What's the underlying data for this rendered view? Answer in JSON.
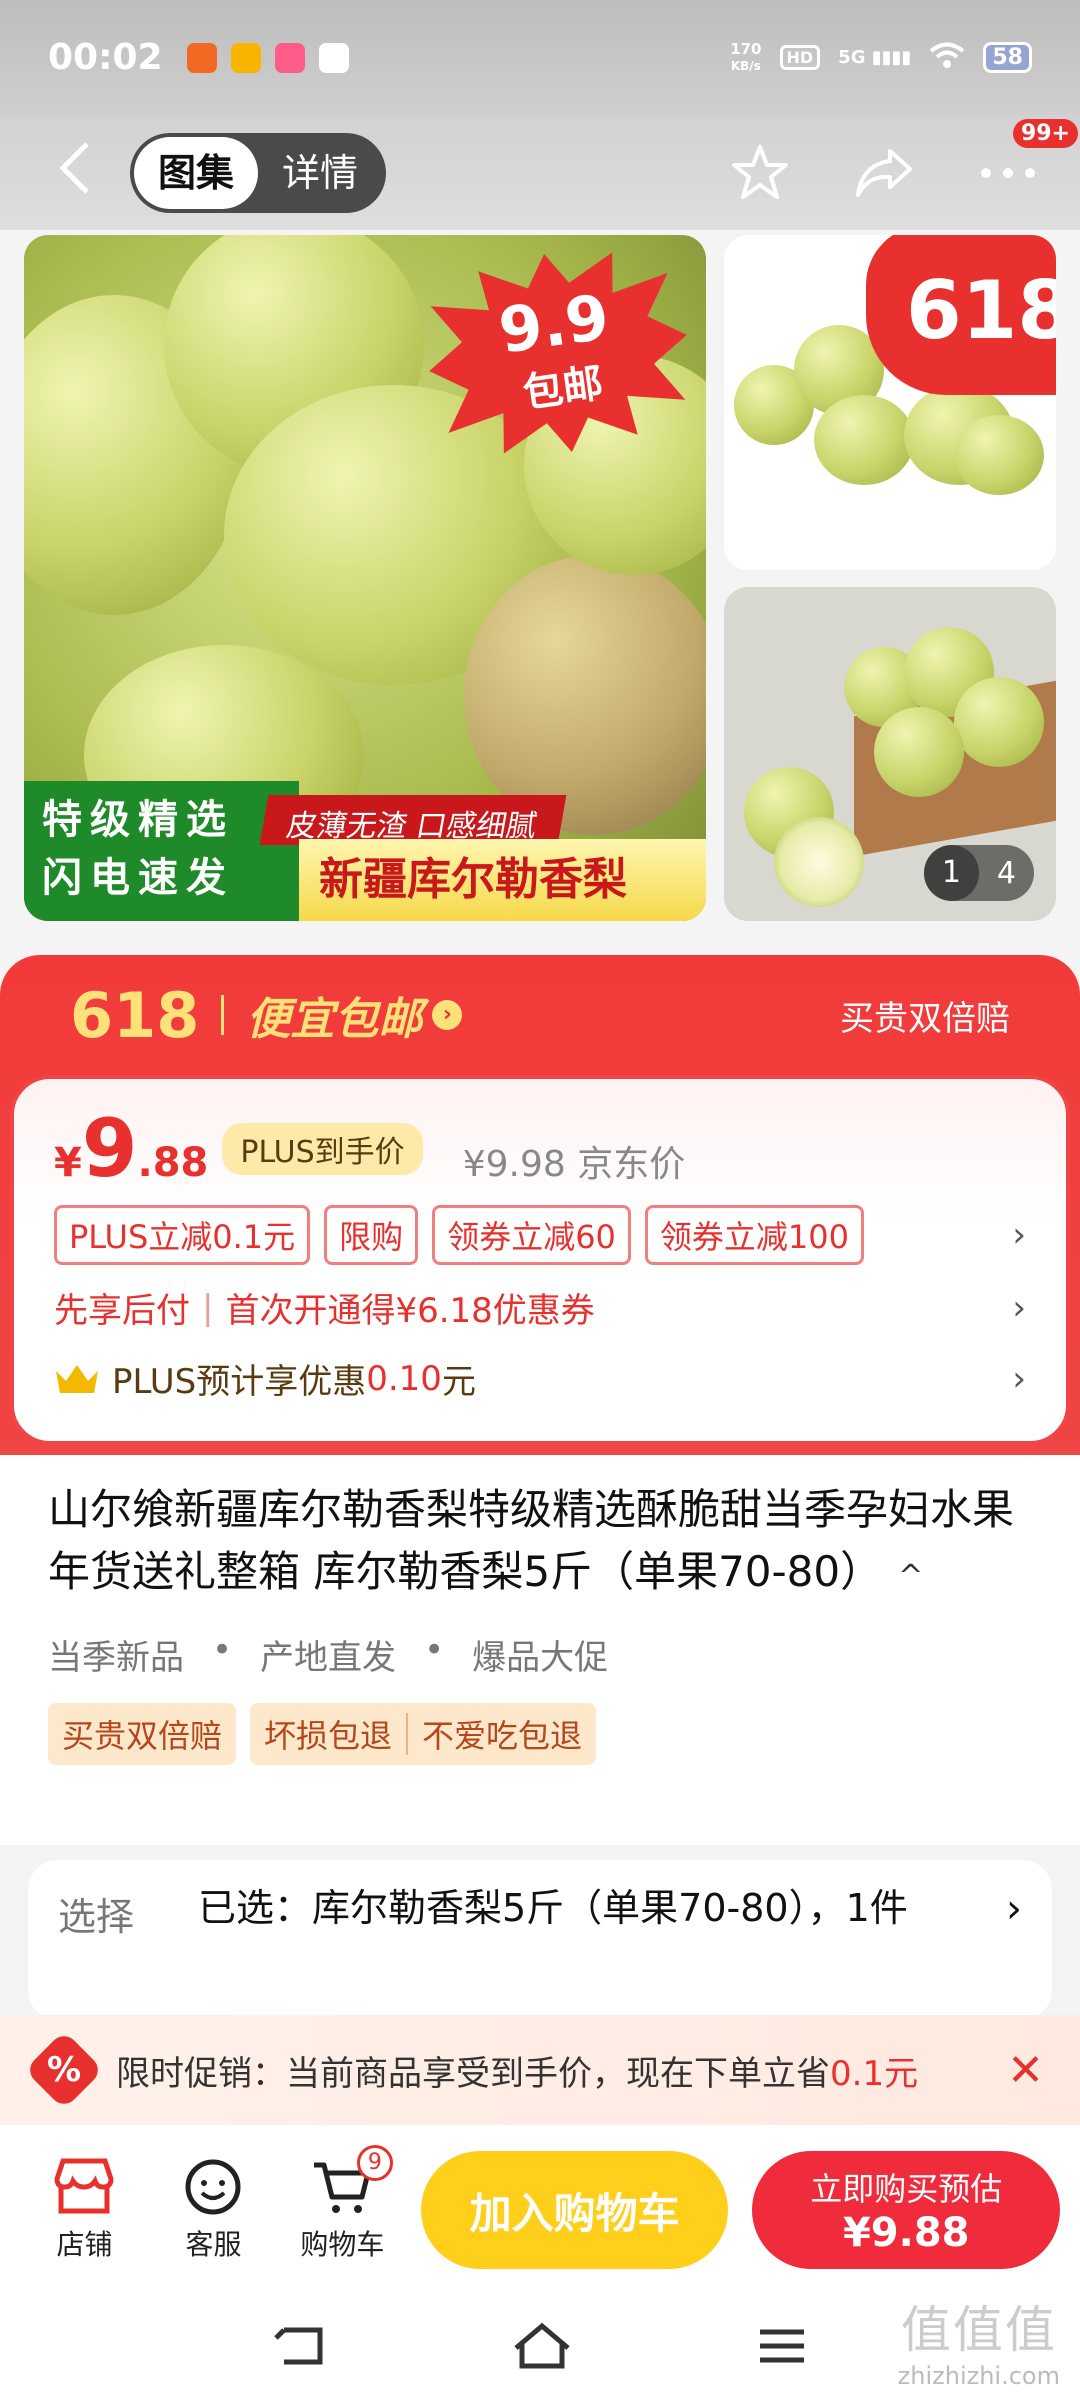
{
  "status_bar": {
    "time": "00:02",
    "net_speed_value": "170",
    "net_speed_unit": "KB/s",
    "hd": "HD",
    "signal": "5G",
    "battery": "58"
  },
  "nav": {
    "tabs": [
      {
        "label": "图集",
        "active": true
      },
      {
        "label": "详情",
        "active": false
      }
    ],
    "more_badge": "99+"
  },
  "gallery": {
    "main_burst_price": "9.9",
    "main_burst_label": "包邮",
    "banner_green_line1": "特级精选",
    "banner_green_line2": "闪电速发",
    "banner_red": "皮薄无渣 口感细腻",
    "banner_yellow": "新疆库尔勒香梨",
    "thumb_badge": "618",
    "counter_current": "1",
    "counter_total": "4"
  },
  "promo": {
    "tag": "618",
    "slogan": "便宜包邮",
    "guarantee": "买贵双倍赔",
    "price_currency": "¥",
    "price_integer": "9",
    "price_decimal": ".88",
    "plus_tag": "PLUS到手价",
    "jd_price": "¥9.98 京东价",
    "coupons": [
      "PLUS立减0.1元",
      "限购",
      "领券立减60",
      "领券立减100"
    ],
    "credit_part1": "先享后付",
    "credit_part2": "首次开通得¥6.18优惠券",
    "plus_saving_label": "PLUS预计享优惠",
    "plus_saving_amount": "0.10",
    "plus_saving_unit": "元"
  },
  "product": {
    "title": "山尔飨新疆库尔勒香梨特级精选酥脆甜当季孕妇水果年货送礼整箱 库尔勒香梨5斤（单果70-80）",
    "collapse_icon": "^",
    "features": [
      "当季新品",
      "产地直发",
      "爆品大促"
    ],
    "service_tags": [
      "买贵双倍赔",
      "坏损包退",
      "不爱吃包退"
    ]
  },
  "selection": {
    "label": "选择",
    "value": "已选：库尔勒香梨5斤（单果70-80），1件"
  },
  "timed_promo": {
    "icon": "%",
    "text": "限时促销：当前商品享受到手价，现在下单立省",
    "amount": "0.1元",
    "close": "✕"
  },
  "actions": {
    "store": "店铺",
    "service": "客服",
    "cart": "购物车",
    "cart_count": "9",
    "add_to_cart": "加入购物车",
    "buy_now_line1": "立即购买预估",
    "buy_now_line2": "¥9.88"
  },
  "watermark": {
    "logo": "值值值",
    "url": "zhizhizhi.com"
  },
  "colors": {
    "accent_red": "#e8312e",
    "cart_yellow": "#ffcf1c",
    "plus_gold": "#fde9a8"
  }
}
